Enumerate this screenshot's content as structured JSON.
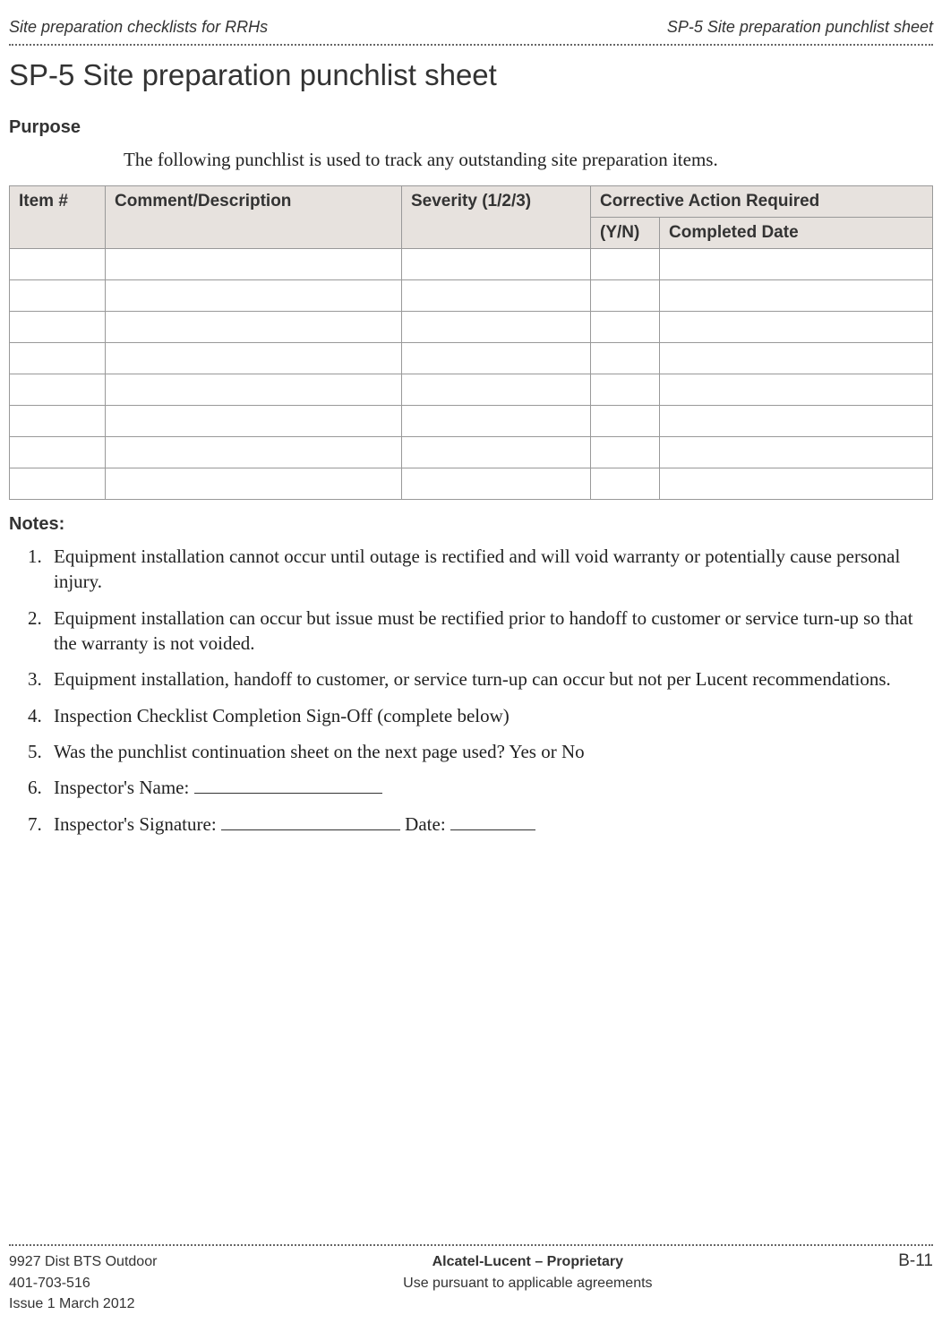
{
  "header": {
    "left": "Site preparation checklists for RRHs",
    "right": "SP-5 Site preparation punchlist sheet"
  },
  "title": "SP-5 Site preparation punchlist sheet",
  "purpose_heading": "Purpose",
  "intro": "The following punchlist is used to track any outstanding site preparation items.",
  "table": {
    "headers": {
      "item": "Item #",
      "comment": "Comment/Description",
      "severity": "Severity (1/2/3)",
      "corrective": "Corrective Action Required",
      "yn": "(Y/N)",
      "completed": "Completed Date"
    },
    "rows": [
      {
        "item": "",
        "comment": "",
        "severity": "",
        "yn": "",
        "completed": ""
      },
      {
        "item": "",
        "comment": "",
        "severity": "",
        "yn": "",
        "completed": ""
      },
      {
        "item": "",
        "comment": "",
        "severity": "",
        "yn": "",
        "completed": ""
      },
      {
        "item": "",
        "comment": "",
        "severity": "",
        "yn": "",
        "completed": ""
      },
      {
        "item": "",
        "comment": "",
        "severity": "",
        "yn": "",
        "completed": ""
      },
      {
        "item": "",
        "comment": "",
        "severity": "",
        "yn": "",
        "completed": ""
      },
      {
        "item": "",
        "comment": "",
        "severity": "",
        "yn": "",
        "completed": ""
      },
      {
        "item": "",
        "comment": "",
        "severity": "",
        "yn": "",
        "completed": ""
      }
    ]
  },
  "notes_heading": "Notes:",
  "notes": [
    "Equipment installation cannot occur until outage is rectified and will void warranty or potentially cause personal injury.",
    "Equipment installation can occur but issue must be rectified prior to handoff to customer or service turn-up so that the warranty is not voided.",
    "Equipment installation, handoff to customer, or service turn-up can occur but not per Lucent recommendations.",
    "Inspection Checklist Completion Sign-Off (complete below)",
    "Was the punchlist continuation sheet on the next page used? Yes or No"
  ],
  "note6_label": "Inspector's Name: ",
  "note7_label": "Inspector's Signature: ",
  "note7_date_label": " Date: ",
  "footer": {
    "left_line1": "9927 Dist BTS Outdoor",
    "left_line2": "401-703-516",
    "left_line3": "Issue 1   March 2012",
    "center_line1": "Alcatel-Lucent – Proprietary",
    "center_line2": "Use pursuant to applicable agreements",
    "right": "B-11"
  }
}
